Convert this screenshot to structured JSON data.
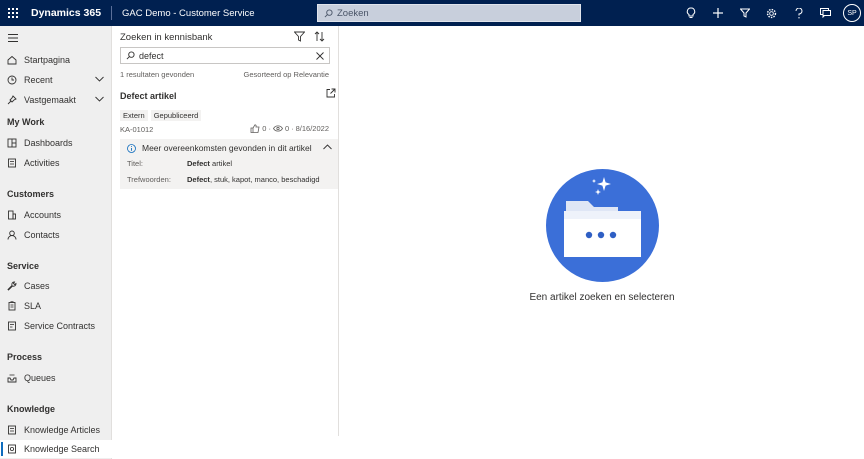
{
  "topbar": {
    "brand": "Dynamics 365",
    "app_name": "GAC Demo - Customer Service",
    "search_placeholder": "Zoeken",
    "avatar_initials": "SP",
    "icons": [
      "lightbulb-icon",
      "plus-icon",
      "filter-icon",
      "gear-icon",
      "help-icon",
      "chat-icon"
    ]
  },
  "nav": {
    "home": "Startpagina",
    "recent": "Recent",
    "pinned": "Vastgemaakt",
    "sections": [
      {
        "title": "My Work",
        "items": [
          "Dashboards",
          "Activities"
        ]
      },
      {
        "title": "Customers",
        "items": [
          "Accounts",
          "Contacts"
        ]
      },
      {
        "title": "Service",
        "items": [
          "Cases",
          "SLA",
          "Service Contracts"
        ]
      },
      {
        "title": "Process",
        "items": [
          "Queues"
        ]
      },
      {
        "title": "Knowledge",
        "items": [
          "Knowledge Articles",
          "Knowledge Search"
        ]
      }
    ],
    "active_item": "Knowledge Search"
  },
  "knowledge": {
    "title": "Zoeken in kennisbank",
    "search_value": "defect",
    "results_count": "1 resultaten gevonden",
    "sorted_by": "Gesorteerd op Relevantie",
    "article": {
      "title": "Defect artikel",
      "tags": [
        "Extern",
        "Gepubliceerd"
      ],
      "id": "KA-01012",
      "likes": "0",
      "views": "0",
      "date": "8/16/2022",
      "matches_header": "Meer overeenkomsten gevonden in dit artikel",
      "match_title_label": "Titel:",
      "match_title_bold": "Defect",
      "match_title_rest": " artikel",
      "match_keywords_label": "Trefwoorden:",
      "match_keywords_bold": "Defect",
      "match_keywords_rest": ", stuk, kapot, manco, beschadigd"
    }
  },
  "empty_state": {
    "message": "Een artikel zoeken en selecteren",
    "icon": "folder-sparkle-icon",
    "circle_color": "#3b6fd8"
  },
  "colors": {
    "topbar": "#002050",
    "nav_bg": "#efefef",
    "accent": "#0f6cbd"
  }
}
